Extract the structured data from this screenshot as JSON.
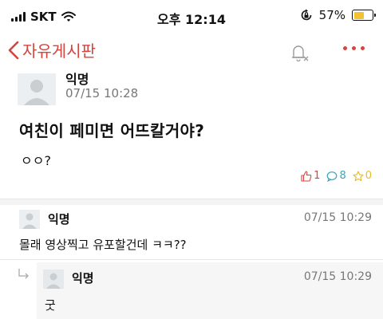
{
  "status_bar": {
    "carrier": "SKT",
    "time": "오후 12:14",
    "battery_percent": "57%",
    "battery_level": 0.57
  },
  "nav": {
    "title": "자유게시판",
    "accent_color": "#d2463f"
  },
  "post": {
    "author": "익명",
    "date": "07/15 10:28",
    "title": "여친이 페미면 어뜨칼거야?",
    "body": "ㅇㅇ?",
    "likes": "1",
    "comments": "8",
    "scraps": "0"
  },
  "comments": [
    {
      "author": "익명",
      "date": "07/15 10:29",
      "text": "몰래 영상찍고 유포할건데 ㅋㅋ??"
    }
  ],
  "replies": [
    {
      "author": "익명",
      "date": "07/15 10:29",
      "text": "굿"
    }
  ]
}
